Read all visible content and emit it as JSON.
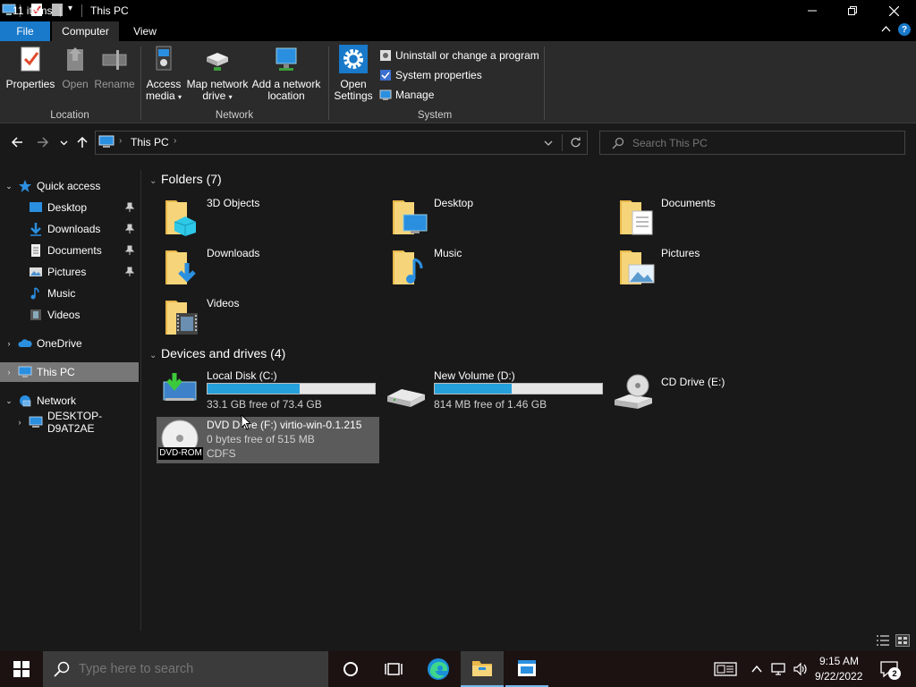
{
  "window": {
    "title": "This PC"
  },
  "ribbon": {
    "tabs": [
      {
        "label": "File"
      },
      {
        "label": "Computer"
      },
      {
        "label": "View"
      }
    ],
    "location": {
      "label": "Location",
      "buttons": [
        {
          "label": "Properties",
          "icon": "properties-icon",
          "enabled": true
        },
        {
          "label": "Open",
          "icon": "open-icon",
          "enabled": false
        },
        {
          "label": "Rename",
          "icon": "rename-icon",
          "enabled": false
        }
      ]
    },
    "network": {
      "label": "Network",
      "access_media": [
        "Access",
        "media"
      ],
      "map_drive": [
        "Map network",
        "drive"
      ],
      "add_location": [
        "Add a network",
        "location"
      ]
    },
    "system": {
      "label": "System",
      "open_settings": [
        "Open",
        "Settings"
      ],
      "items": [
        {
          "label": "Uninstall or change a program",
          "icon": "uninstall-icon"
        },
        {
          "label": "System properties",
          "icon": "system-properties-icon"
        },
        {
          "label": "Manage",
          "icon": "manage-icon"
        }
      ]
    }
  },
  "address": {
    "crumb": "This PC",
    "search_placeholder": "Search This PC"
  },
  "nav_pane": {
    "quick_access": "Quick access",
    "pinned": [
      {
        "label": "Desktop",
        "pinned": true
      },
      {
        "label": "Downloads",
        "pinned": true
      },
      {
        "label": "Documents",
        "pinned": true
      },
      {
        "label": "Pictures",
        "pinned": true
      },
      {
        "label": "Music",
        "pinned": false
      },
      {
        "label": "Videos",
        "pinned": false
      }
    ],
    "onedrive": "OneDrive",
    "this_pc": "This PC",
    "network": "Network",
    "network_child": "DESKTOP-D9AT2AE"
  },
  "content": {
    "folders_header": "Folders (7)",
    "folders": [
      {
        "label": "3D Objects"
      },
      {
        "label": "Desktop"
      },
      {
        "label": "Documents"
      },
      {
        "label": "Downloads"
      },
      {
        "label": "Music"
      },
      {
        "label": "Pictures"
      },
      {
        "label": "Videos"
      }
    ],
    "drives_header": "Devices and drives (4)",
    "drives": [
      {
        "name": "Local Disk (C:)",
        "free": "33.1 GB free of 73.4 GB",
        "used_fraction": 0.55
      },
      {
        "name": "New Volume (D:)",
        "free": "814 MB free of 1.46 GB",
        "used_fraction": 0.46
      },
      {
        "name": "CD Drive (E:)"
      },
      {
        "name": "DVD Drive (F:) virtio-win-0.1.215",
        "free": "0 bytes free of 515 MB",
        "fs": "CDFS",
        "badge": "DVD-ROM"
      }
    ]
  },
  "status": {
    "count": "11 items"
  },
  "taskbar": {
    "search_placeholder": "Type here to search",
    "time": "9:15 AM",
    "date": "9/22/2022",
    "notifications": "2"
  },
  "colors": {
    "accent": "#1979ca",
    "bar_fill": "#26a0da",
    "background": "#191919",
    "ribbon": "#2b2b2b"
  }
}
